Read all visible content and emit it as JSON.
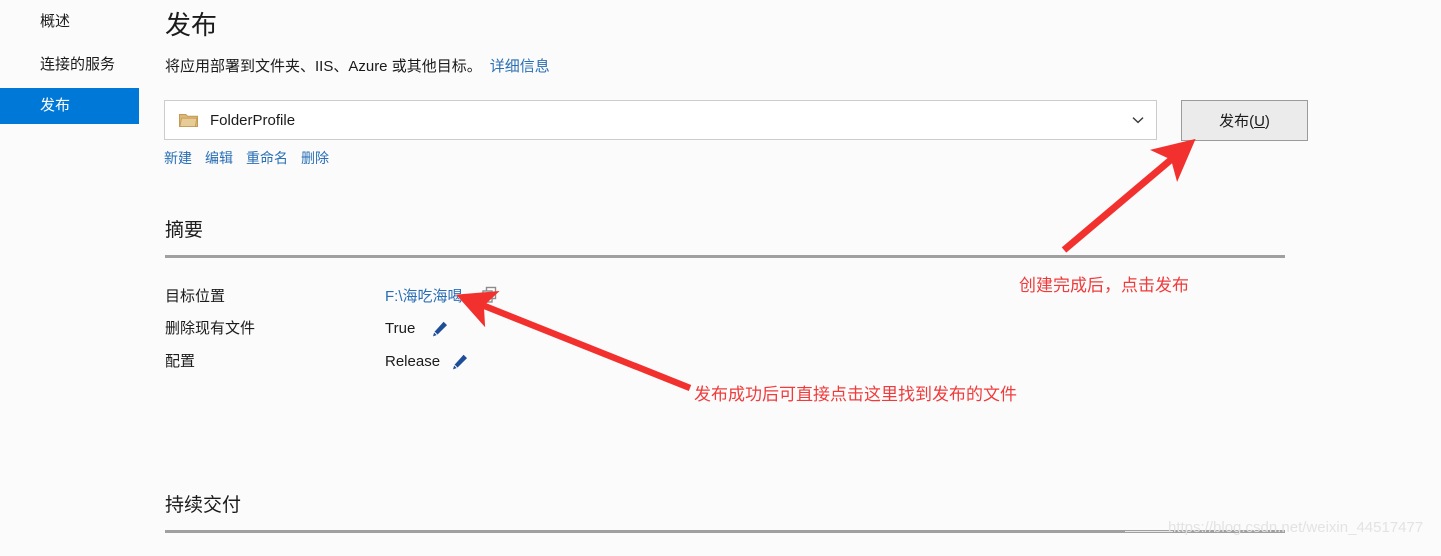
{
  "sidebar": {
    "items": [
      {
        "label": "概述",
        "selected": false
      },
      {
        "label": "连接的服务",
        "selected": false
      },
      {
        "label": "发布",
        "selected": true
      }
    ]
  },
  "page": {
    "title": "发布",
    "subtitle": "将应用部署到文件夹、IIS、Azure 或其他目标。",
    "subtitle_link": "详细信息"
  },
  "profile": {
    "selected": "FolderProfile",
    "folder_icon": "folder-icon",
    "chevron_icon": "chevron-down-icon",
    "publish_button_prefix": "发布(",
    "publish_button_key": "U",
    "publish_button_suffix": ")",
    "actions": [
      "新建",
      "编辑",
      "重命名",
      "删除"
    ]
  },
  "summary": {
    "heading": "摘要",
    "rows": [
      {
        "label": "目标位置",
        "value": "F:\\海吃海喝",
        "value_is_link": true,
        "icon": "copy-icon"
      },
      {
        "label": "删除现有文件",
        "value": "True",
        "value_is_link": false,
        "icon": "pencil-edit-icon"
      },
      {
        "label": "配置",
        "value": "Release",
        "value_is_link": false,
        "icon": "pencil-edit-icon"
      }
    ]
  },
  "continuous_delivery": {
    "heading": "持续交付"
  },
  "annotations": [
    {
      "text": "创建完成后，点击发布"
    },
    {
      "text": "发布成功后可直接点击这里找到发布的文件"
    }
  ],
  "watermark": {
    "text": "https://blog.csdn.net/weixin_44517477"
  },
  "colors": {
    "accent_blue": "#0078d7",
    "link_blue": "#2a6fb5",
    "annotation_red": "#ef3b3b",
    "page_background": "#fbfbfb"
  }
}
